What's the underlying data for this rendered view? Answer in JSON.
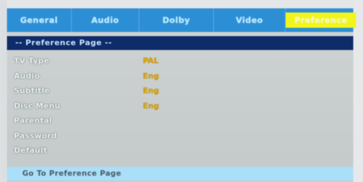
{
  "tabs": [
    {
      "label": "General"
    },
    {
      "label": "Audio"
    },
    {
      "label": "Dolby"
    },
    {
      "label": "Video"
    },
    {
      "label": "Preference"
    }
  ],
  "active_tab_color": "#f1f51c",
  "tabbar_color": "#2c8fd6",
  "header": {
    "title": "-- Preference Page --"
  },
  "settings": [
    {
      "label": "TV Type",
      "value": "PAL"
    },
    {
      "label": "Audio",
      "value": "Eng"
    },
    {
      "label": "Subtitle",
      "value": "Eng"
    },
    {
      "label": "Disc Menu",
      "value": "Eng"
    },
    {
      "label": "Parental",
      "value": ""
    },
    {
      "label": "Password",
      "value": ""
    },
    {
      "label": "Default",
      "value": ""
    }
  ],
  "footer": {
    "text": "Go To Preference Page"
  }
}
